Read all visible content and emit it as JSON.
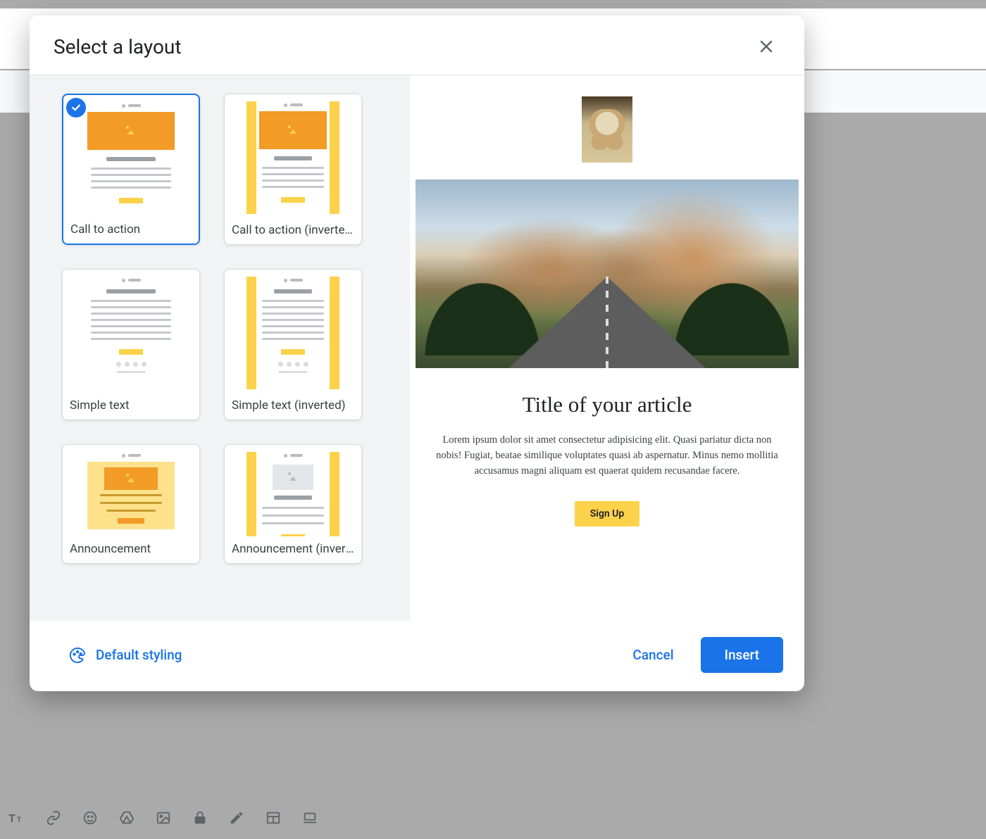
{
  "dialog": {
    "title": "Select a layout",
    "footer": {
      "styling": "Default styling",
      "cancel": "Cancel",
      "insert": "Insert"
    }
  },
  "layouts": [
    {
      "id": "cta",
      "label": "Call to action",
      "selected": true
    },
    {
      "id": "cta-inv",
      "label": "Call to action (inverted)",
      "selected": false
    },
    {
      "id": "simple",
      "label": "Simple text",
      "selected": false
    },
    {
      "id": "simple-inv",
      "label": "Simple text (inverted)",
      "selected": false
    },
    {
      "id": "announce",
      "label": "Announcement",
      "selected": false
    },
    {
      "id": "announce-inv",
      "label": "Announcement (inverted)",
      "selected": false
    }
  ],
  "preview": {
    "title": "Title of your article",
    "paragraph": "Lorem ipsum dolor sit amet consectetur adipisicing elit. Quasi pariatur dicta non nobis! Fugiat, beatae similique voluptates quasi ab aspernatur. Minus nemo mollitia accusamus magni aliquam est quaerat quidem recusandae facere.",
    "cta_label": "Sign Up"
  }
}
